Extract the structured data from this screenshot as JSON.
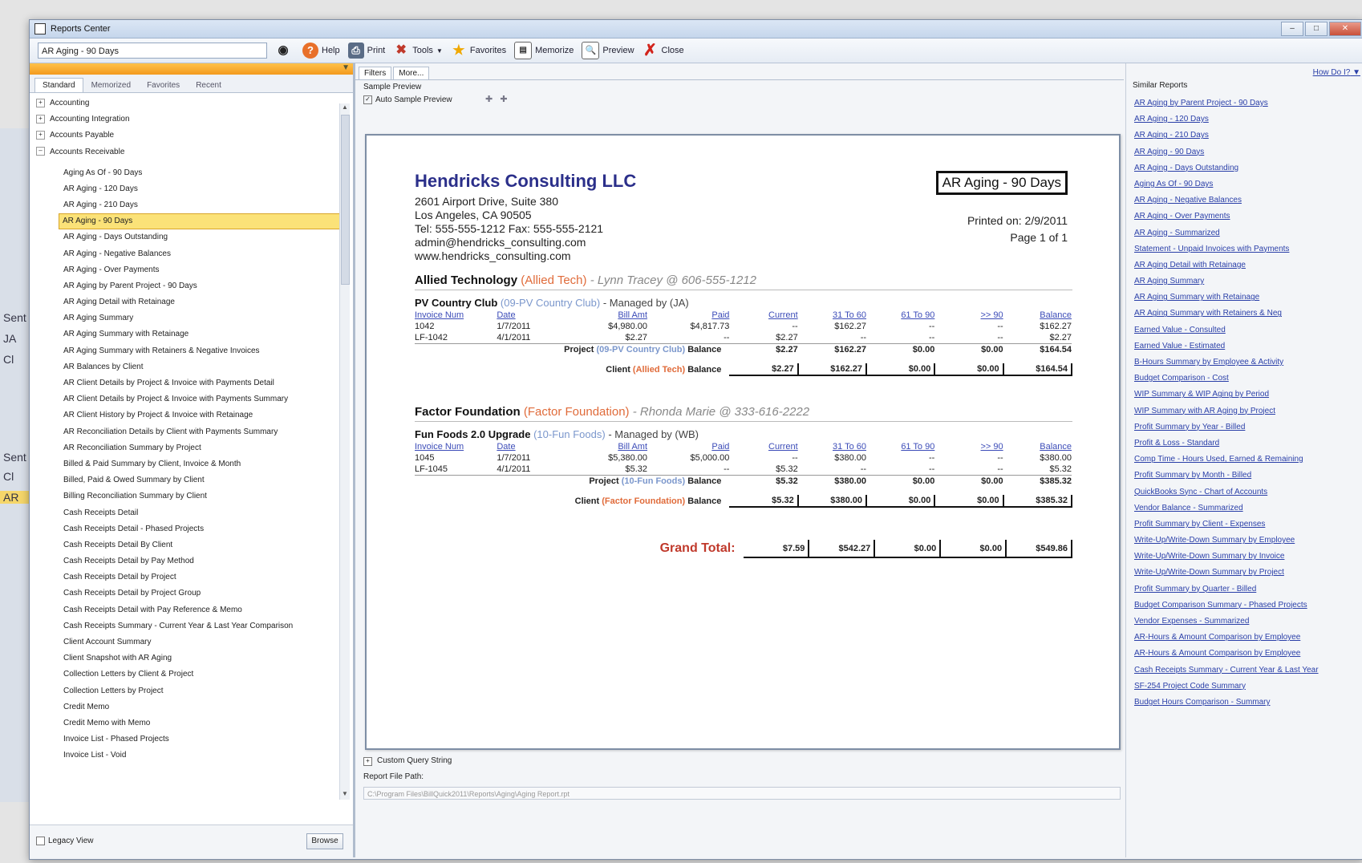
{
  "window": {
    "title": "Reports Center"
  },
  "toolbar": {
    "report_select": "AR Aging - 90 Days",
    "help": "Help",
    "print": "Print",
    "tools": "Tools",
    "favorites": "Favorites",
    "memorize": "Memorize",
    "preview": "Preview",
    "close": "Close"
  },
  "left": {
    "tabs": [
      "Standard",
      "Memorized",
      "Favorites",
      "Recent"
    ],
    "categories": [
      "Accounting",
      "Accounting Integration",
      "Accounts Payable",
      "Accounts Receivable"
    ],
    "reports": [
      "Aging As Of - 90 Days",
      "AR Aging - 120 Days",
      "AR Aging - 210 Days",
      "AR Aging - 90 Days",
      "AR Aging - Days Outstanding",
      "AR Aging - Negative Balances",
      "AR Aging - Over Payments",
      "AR Aging by Parent Project - 90 Days",
      "AR Aging Detail with Retainage",
      "AR Aging Summary",
      "AR Aging Summary with Retainage",
      "AR Aging Summary with Retainers & Negative Invoices",
      "AR Balances by Client",
      "AR Client Details by Project & Invoice with Payments Detail",
      "AR Client Details by Project & Invoice with Payments Summary",
      "AR Client History by Project & Invoice with Retainage",
      "AR Reconciliation Details by Client with Payments Summary",
      "AR Reconciliation Summary by Project",
      "Billed & Paid Summary by Client, Invoice & Month",
      "Billed, Paid & Owed Summary by Client",
      "Billing Reconciliation Summary by Client",
      "Cash Receipts Detail",
      "Cash Receipts Detail - Phased Projects",
      "Cash Receipts Detail By Client",
      "Cash Receipts Detail by Pay Method",
      "Cash Receipts Detail by Project",
      "Cash Receipts Detail by Project Group",
      "Cash Receipts Detail with Pay Reference & Memo",
      "Cash Receipts Summary - Current Year & Last Year Comparison",
      "Client Account Summary",
      "Client Snapshot with AR Aging",
      "Collection Letters by Client & Project",
      "Collection Letters by Project",
      "Credit Memo",
      "Credit Memo with Memo",
      "Invoice List - Phased Projects",
      "Invoice List - Void"
    ],
    "legacy_view": "Legacy View",
    "browse": "Browse"
  },
  "background": {
    "items": [
      "Sent",
      "JA",
      "Cl",
      "Sent",
      "Cl",
      "AR"
    ]
  },
  "center": {
    "tabs": [
      "Filters",
      "More..."
    ],
    "sample_preview": "Sample Preview",
    "auto_sample": "Auto Sample Preview",
    "custom_query": "Custom Query String",
    "report_file_path": "Report File Path:",
    "path_value": "C:\\Program Files\\BillQuick2011\\Reports\\Aging\\Aging Report.rpt"
  },
  "report": {
    "company": "Hendricks Consulting LLC",
    "address": [
      "2601 Airport Drive, Suite 380",
      "Los Angeles, CA 90505",
      "Tel: 555-555-1212  Fax: 555-555-2121",
      "admin@hendricks_consulting.com",
      "www.hendricks_consulting.com"
    ],
    "title": "AR Aging - 90 Days",
    "printed": "Printed on: 2/9/2011",
    "page": "Page 1 of 1",
    "columns": [
      "Invoice Num",
      "Date",
      "Bill Amt",
      "Paid",
      "Current",
      "31 To 60",
      "61 To 90",
      ">> 90",
      "Balance"
    ],
    "clients": [
      {
        "name": "Allied Technology",
        "short": "(Allied Tech)",
        "contact": "- Lynn Tracey @ 606-555-1212",
        "project": "PV Country Club",
        "project_code": "(09-PV Country Club)",
        "manager": "- Managed by (JA)",
        "rows": [
          [
            "1042",
            "1/7/2011",
            "$4,980.00",
            "$4,817.73",
            "--",
            "$162.27",
            "--",
            "--",
            "$162.27"
          ],
          [
            "LF-1042",
            "4/1/2011",
            "$2.27",
            "--",
            "$2.27",
            "--",
            "--",
            "--",
            "$2.27"
          ]
        ],
        "project_bal_label": "Project",
        "project_bal_name": "(09-PV Country Club)",
        "balance_word": "Balance",
        "project_bal": [
          "$2.27",
          "$162.27",
          "$0.00",
          "$0.00",
          "$164.54"
        ],
        "client_bal_label": "Client",
        "client_bal_name": "(Allied Tech)",
        "client_bal": [
          "$2.27",
          "$162.27",
          "$0.00",
          "$0.00",
          "$164.54"
        ]
      },
      {
        "name": "Factor Foundation",
        "short": "(Factor Foundation)",
        "contact": "- Rhonda Marie @ 333-616-2222",
        "project": "Fun Foods 2.0 Upgrade",
        "project_code": "(10-Fun Foods)",
        "manager": "- Managed by (WB)",
        "rows": [
          [
            "1045",
            "1/7/2011",
            "$5,380.00",
            "$5,000.00",
            "--",
            "$380.00",
            "--",
            "--",
            "$380.00"
          ],
          [
            "LF-1045",
            "4/1/2011",
            "$5.32",
            "--",
            "$5.32",
            "--",
            "--",
            "--",
            "$5.32"
          ]
        ],
        "project_bal_label": "Project",
        "project_bal_name": "(10-Fun Foods)",
        "balance_word": "Balance",
        "project_bal": [
          "$5.32",
          "$380.00",
          "$0.00",
          "$0.00",
          "$385.32"
        ],
        "client_bal_label": "Client",
        "client_bal_name": "(Factor Foundation)",
        "client_bal": [
          "$5.32",
          "$380.00",
          "$0.00",
          "$0.00",
          "$385.32"
        ]
      }
    ],
    "grand_label": "Grand Total:",
    "grand": [
      "$7.59",
      "$542.27",
      "$0.00",
      "$0.00",
      "$549.86"
    ]
  },
  "right": {
    "how_do_i": "How Do I?",
    "similar_label": "Similar Reports",
    "similar": [
      "AR Aging by Parent Project - 90 Days",
      "AR Aging - 120 Days",
      "AR Aging - 210 Days",
      "AR Aging - 90 Days",
      "AR Aging - Days Outstanding",
      "Aging As Of - 90 Days",
      "AR Aging - Negative Balances",
      "AR Aging - Over Payments",
      "AR Aging - Summarized",
      "Statement - Unpaid Invoices with Payments",
      "AR Aging Detail with Retainage",
      "AR Aging Summary",
      "AR Aging Summary with Retainage",
      "AR Aging Summary with Retainers & Neg",
      "Earned Value - Consulted",
      "Earned Value - Estimated",
      "B-Hours Summary by Employee & Activity",
      "Budget Comparison - Cost",
      "WIP Summary & WIP Aging by Period",
      "WIP Summary with AR Aging by Project",
      "Profit Summary by Year - Billed",
      "Profit & Loss - Standard",
      "Comp Time - Hours Used, Earned & Remaining",
      "Profit Summary by Month - Billed",
      "QuickBooks Sync - Chart of Accounts",
      "Vendor Balance - Summarized",
      "Profit Summary by Client - Expenses",
      "Write-Up/Write-Down Summary by Employee",
      "Write-Up/Write-Down Summary by Invoice",
      "Write-Up/Write-Down Summary by Project",
      "Profit Summary by Quarter - Billed",
      "Budget Comparison Summary - Phased Projects",
      "Vendor Expenses - Summarized",
      "AR-Hours & Amount Comparison by Employee",
      "AR-Hours & Amount Comparison by Employee",
      "Cash Receipts Summary - Current Year & Last Year",
      "SF-254 Project Code Summary",
      "Budget Hours Comparison - Summary"
    ]
  }
}
